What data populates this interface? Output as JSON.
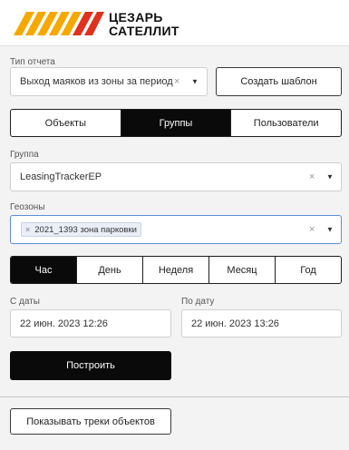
{
  "brand": {
    "line1": "ЦЕЗАРЬ",
    "line2": "САТЕЛЛИТ",
    "accent_color": "#f5a800",
    "accent_red": "#e0301e"
  },
  "report_type": {
    "label": "Тип отчета",
    "value": "Выход маяков из зоны за период",
    "clear": "×",
    "caret": "▼"
  },
  "create_template_label": "Создать шаблон",
  "entity_tabs": [
    "Объекты",
    "Группы",
    "Пользователи"
  ],
  "entity_tab_active": "Группы",
  "group": {
    "label": "Группа",
    "value": "LeasingTrackerEP",
    "clear": "×",
    "caret": "▼"
  },
  "geozones": {
    "label": "Геозоны",
    "tag": "2021_1393 зона парковки",
    "tag_remove": "×",
    "clear": "×",
    "caret": "▼"
  },
  "period_tabs": [
    "Час",
    "День",
    "Неделя",
    "Месяц",
    "Год"
  ],
  "period_tab_active": "Час",
  "date_from": {
    "label": "С даты",
    "value": "22 июн. 2023 12:26"
  },
  "date_to": {
    "label": "По дату",
    "value": "22 июн. 2023 13:26"
  },
  "build_label": "Построить",
  "show_tracks_label": "Показывать треки объектов"
}
